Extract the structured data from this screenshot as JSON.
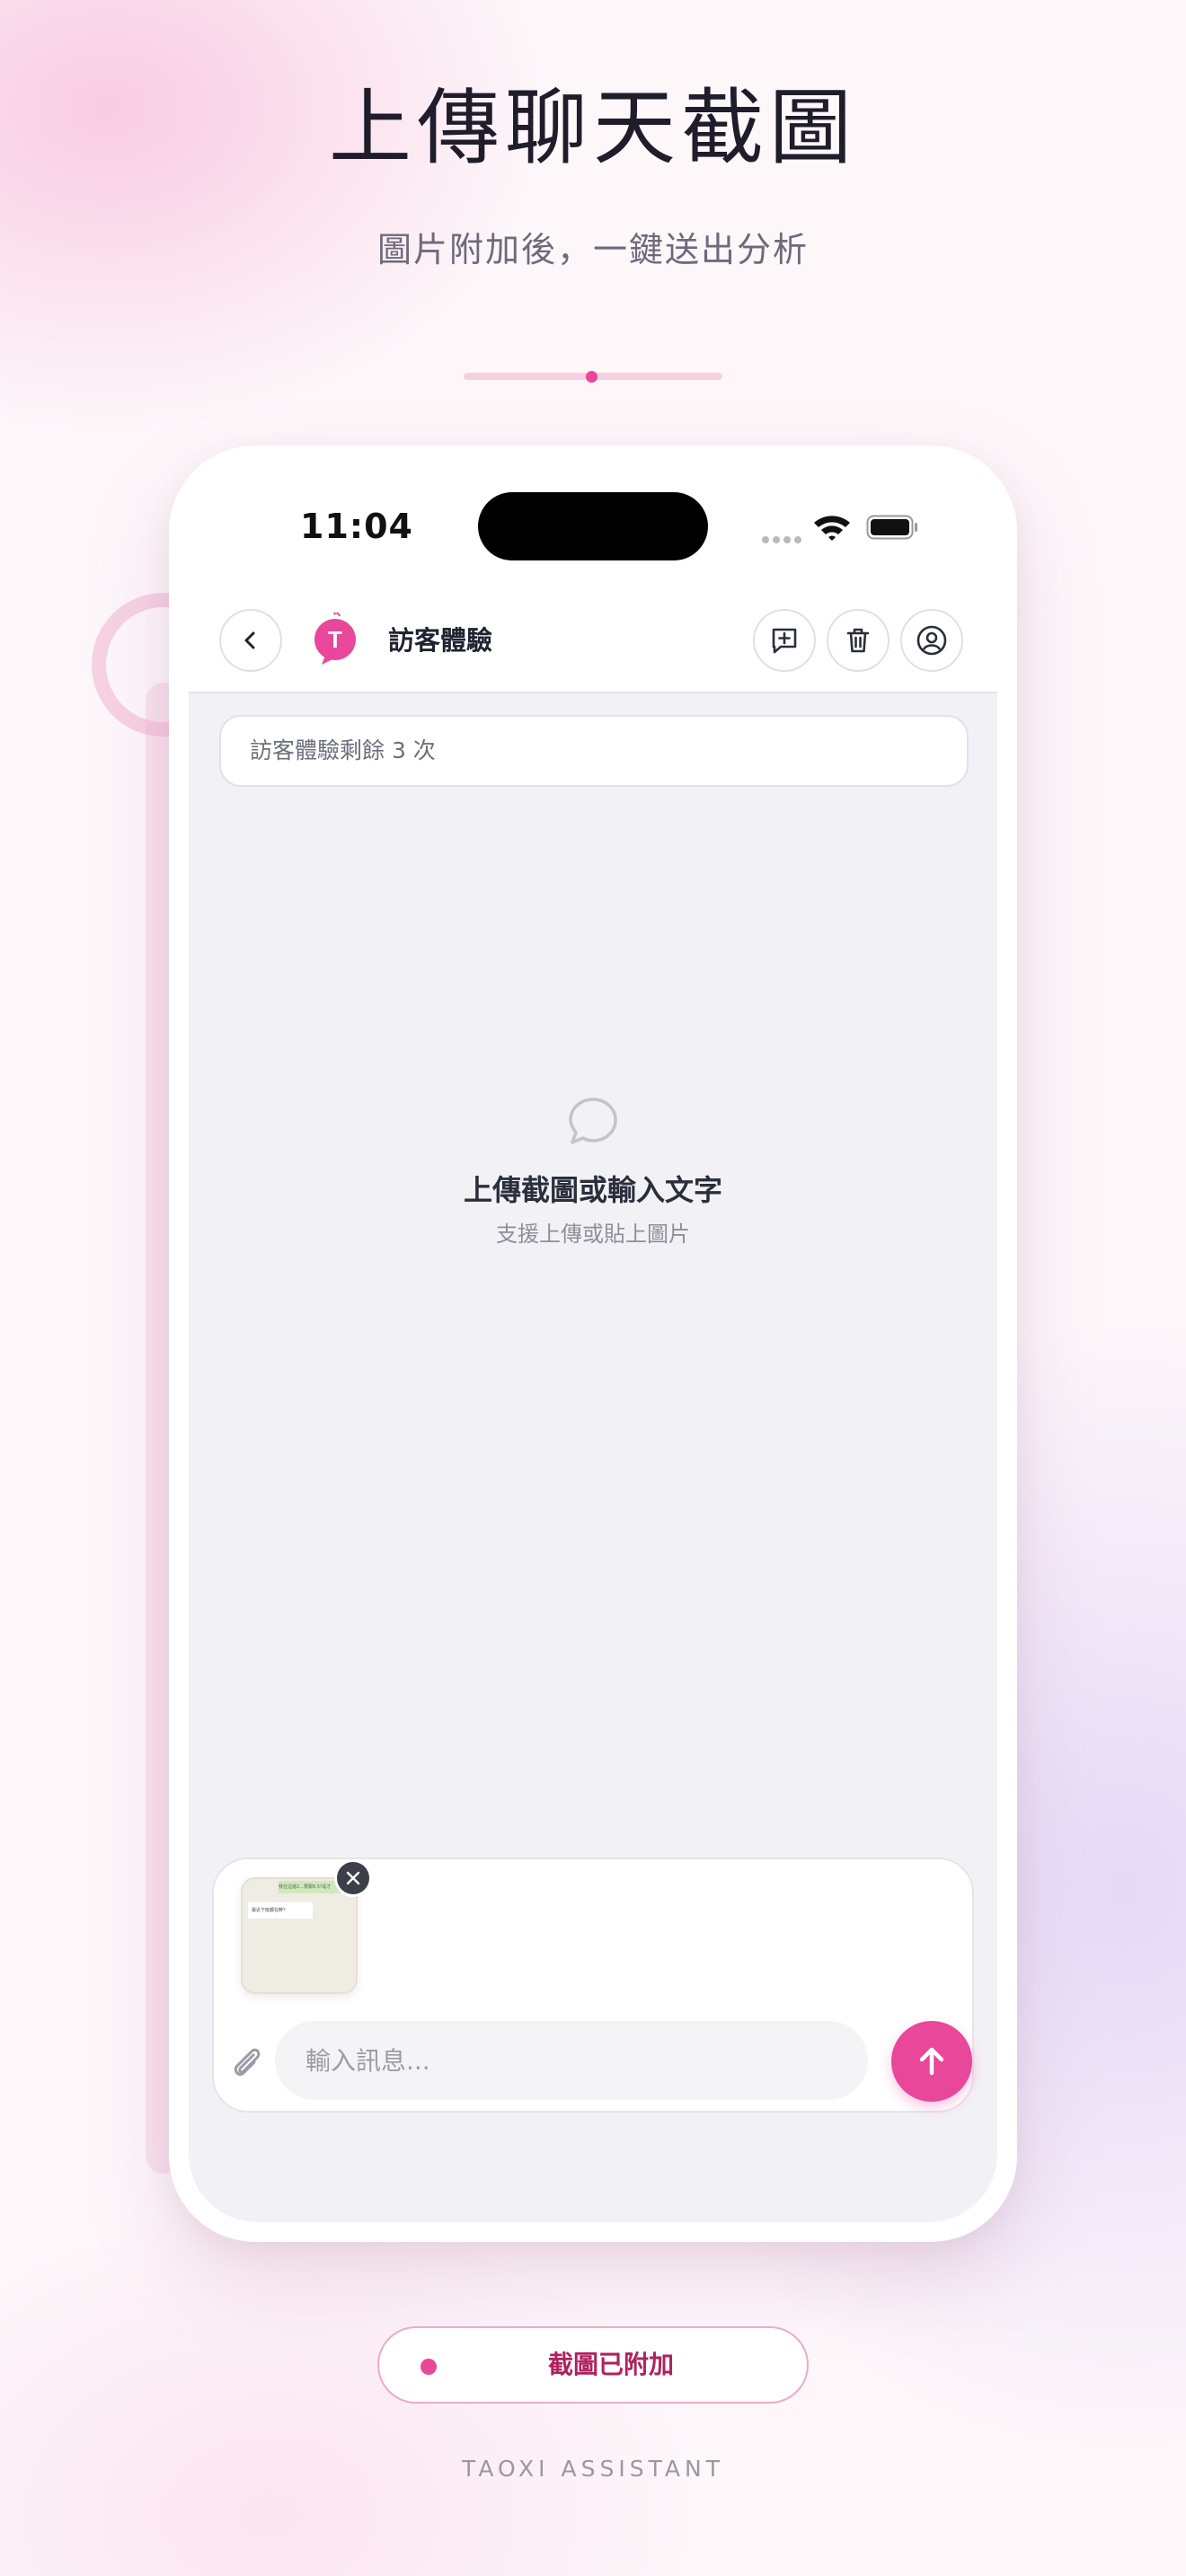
{
  "hero": {
    "title": "上傳聊天截圖",
    "subtitle": "圖片附加後，一鍵送出分析"
  },
  "status_bar": {
    "time": "11:04"
  },
  "app_bar": {
    "avatar_letter": "T",
    "title": "訪客體驗"
  },
  "guest_banner": {
    "text": "訪客體驗剩餘 3 次"
  },
  "empty_state": {
    "icon": "chat-bubble-icon",
    "title": "上傳截圖或輸入文字",
    "subtitle": "支援上傳或貼上圖片"
  },
  "composer": {
    "attachment": {
      "preview_top_text": "我在這邊2...要跟8,5?是才",
      "preview_msg_text": "最近下班都在幹？"
    },
    "input_placeholder": "輸入訊息...",
    "icons": {
      "remove": "close-icon",
      "attach": "paperclip-icon",
      "send": "arrow-up-icon"
    }
  },
  "status_pill": {
    "text": "截圖已附加"
  },
  "brand": "TAOXI ASSISTANT",
  "colors": {
    "accent": "#e8479a",
    "title": "#1f1d2b",
    "screen_bg": "#f2f1f6",
    "pill_text": "#b0225f"
  }
}
